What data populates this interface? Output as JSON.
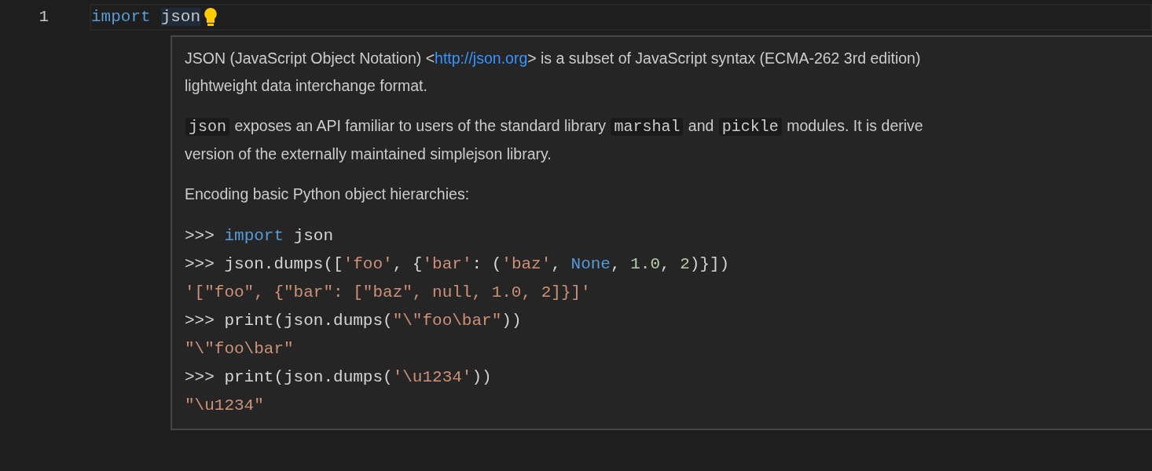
{
  "editor": {
    "line_number": "1",
    "code": [
      {
        "kind": "keyword",
        "text": "import"
      },
      {
        "kind": "selected",
        "text": "json"
      }
    ]
  },
  "hover": {
    "paragraphs": [
      {
        "lines": [
          [
            {
              "kind": "text",
              "text": "JSON (JavaScript Object Notation) <"
            },
            {
              "kind": "link",
              "text": "http://json.org"
            },
            {
              "kind": "text",
              "text": "> is a subset of JavaScript syntax (ECMA-262 3rd edition)"
            }
          ],
          [
            {
              "kind": "text",
              "text": "lightweight data interchange format."
            }
          ]
        ]
      },
      {
        "lines": [
          [
            {
              "kind": "code",
              "text": "json"
            },
            {
              "kind": "text",
              "text": " exposes an API familiar to users of the standard library "
            },
            {
              "kind": "code",
              "text": "marshal"
            },
            {
              "kind": "text",
              "text": " and "
            },
            {
              "kind": "code",
              "text": "pickle"
            },
            {
              "kind": "text",
              "text": " modules. It is derive"
            }
          ],
          [
            {
              "kind": "text",
              "text": "version of the externally maintained simplejson library."
            }
          ]
        ]
      },
      {
        "lines": [
          [
            {
              "kind": "text",
              "text": "Encoding basic Python object hierarchies:"
            }
          ]
        ]
      }
    ],
    "code_block": [
      [
        {
          "kind": "plain",
          "text": ">>> "
        },
        {
          "kind": "keyword",
          "text": "import"
        },
        {
          "kind": "plain",
          "text": " json"
        }
      ],
      [
        {
          "kind": "plain",
          "text": ">>> json.dumps(["
        },
        {
          "kind": "string",
          "text": "'foo'"
        },
        {
          "kind": "plain",
          "text": ", {"
        },
        {
          "kind": "string",
          "text": "'bar'"
        },
        {
          "kind": "plain",
          "text": ": ("
        },
        {
          "kind": "string",
          "text": "'baz'"
        },
        {
          "kind": "plain",
          "text": ", "
        },
        {
          "kind": "keyword",
          "text": "None"
        },
        {
          "kind": "plain",
          "text": ", "
        },
        {
          "kind": "number",
          "text": "1.0"
        },
        {
          "kind": "plain",
          "text": ", "
        },
        {
          "kind": "number",
          "text": "2"
        },
        {
          "kind": "plain",
          "text": ")}])"
        }
      ],
      [
        {
          "kind": "string",
          "text": "'[\"foo\", {\"bar\": [\"baz\", null, 1.0, 2]}]'"
        }
      ],
      [
        {
          "kind": "plain",
          "text": ">>> print(json.dumps("
        },
        {
          "kind": "string",
          "text": "\"\\\"foo\\bar\""
        },
        {
          "kind": "plain",
          "text": "))"
        }
      ],
      [
        {
          "kind": "string",
          "text": "\"\\\"foo\\bar\""
        }
      ],
      [
        {
          "kind": "plain",
          "text": ">>> print(json.dumps("
        },
        {
          "kind": "string",
          "text": "'\\u1234'"
        },
        {
          "kind": "plain",
          "text": "))"
        }
      ],
      [
        {
          "kind": "string",
          "text": "\"\\u1234\""
        }
      ]
    ]
  }
}
